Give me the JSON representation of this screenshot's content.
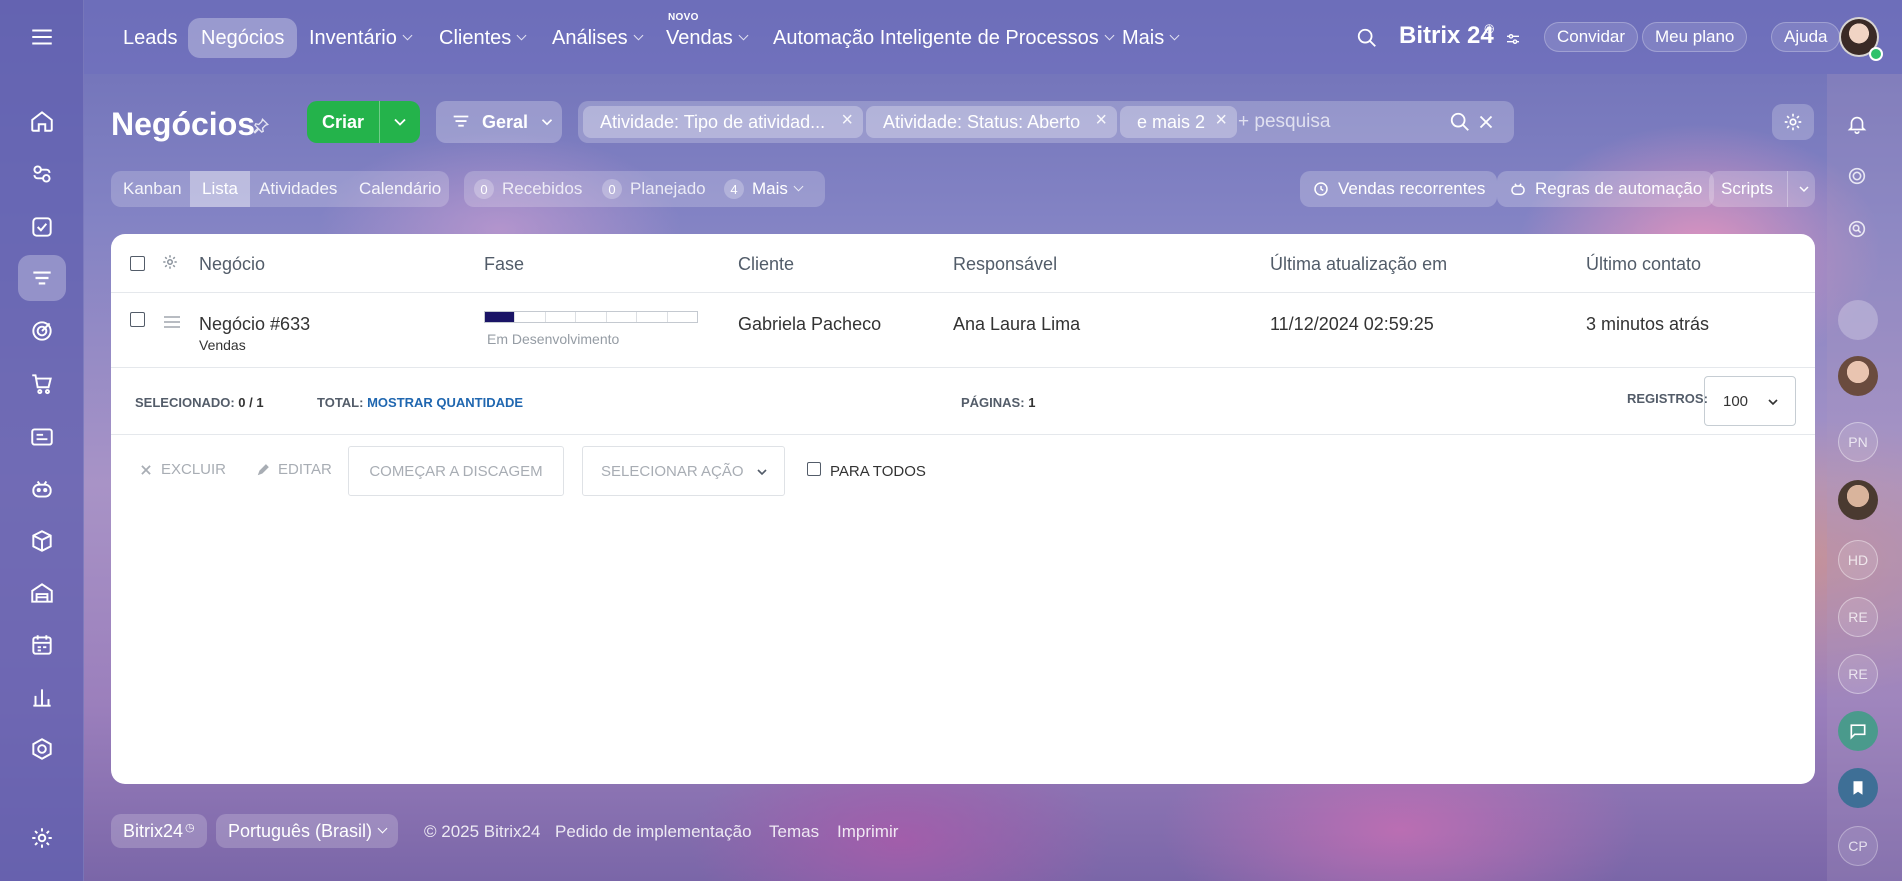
{
  "topnav": {
    "items": [
      "Leads",
      "Negócios",
      "Inventário",
      "Clientes",
      "Análises",
      "Vendas",
      "Automação Inteligente de Processos",
      "Mais"
    ],
    "new_badge": "NOVO",
    "brand": "Bitrix 24",
    "invite": "Convidar",
    "plan": "Meu plano",
    "help": "Ajuda"
  },
  "header": {
    "title": "Negócios",
    "create": "Criar",
    "general": "Geral",
    "filters": [
      "Atividade: Tipo de atividad...",
      "Atividade: Status: Aberto",
      "e mais 2"
    ],
    "search_placeholder": "+ pesquisa"
  },
  "views": {
    "tabs": [
      "Kanban",
      "Lista",
      "Atividades",
      "Calendário"
    ],
    "counters": [
      {
        "num": "0",
        "label": "Recebidos"
      },
      {
        "num": "0",
        "label": "Planejado"
      },
      {
        "num": "4",
        "label": "Mais"
      }
    ],
    "recurring": "Vendas recorrentes",
    "automation": "Regras de automação",
    "scripts": "Scripts"
  },
  "table": {
    "columns": [
      "Negócio",
      "Fase",
      "Cliente",
      "Responsável",
      "Última atualização em",
      "Último contato"
    ],
    "rows": [
      {
        "deal": "Negócio #633",
        "pipeline": "Vendas",
        "stage": "Em Desenvolvimento",
        "stage_progress": 0.143,
        "client": "Gabriela Pacheco",
        "owner": "Ana Laura Lima",
        "updated": "11/12/2024 02:59:25",
        "last_contact": "3 minutos atrás"
      }
    ]
  },
  "summary": {
    "selected_label": "SELECIONADO:",
    "selected_value": "0 / 1",
    "total_label": "TOTAL:",
    "total_link": "MOSTRAR QUANTIDADE",
    "pages_label": "PÁGINAS:",
    "pages_value": "1",
    "records_label": "REGISTROS:",
    "records_value": "100"
  },
  "actions": {
    "delete": "EXCLUIR",
    "edit": "EDITAR",
    "dial": "COMEÇAR A DISCAGEM",
    "select_action": "SELECIONAR AÇÃO",
    "for_all": "PARA TODOS"
  },
  "footer": {
    "brand": "Bitrix24",
    "language": "Português (Brasil)",
    "copyright": "© 2025 Bitrix24",
    "implementation": "Pedido de implementação",
    "themes": "Temas",
    "print": "Imprimir"
  },
  "rail": {
    "initials": [
      "PN",
      "HD",
      "RE",
      "RE",
      "CP"
    ]
  },
  "colors": {
    "accent_green": "#24b34b",
    "link_blue": "#2067b0",
    "progress_fill": "#1a1466"
  }
}
